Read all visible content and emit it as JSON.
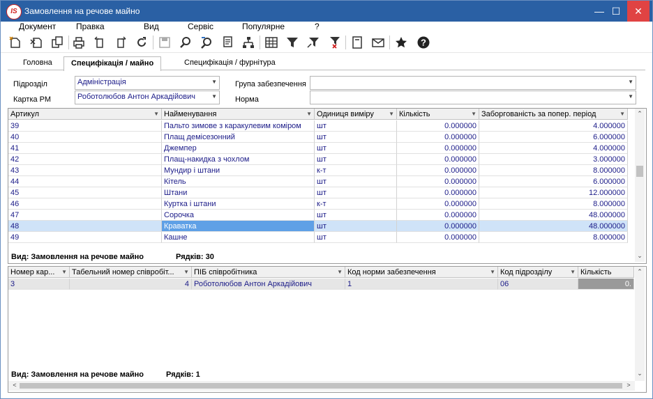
{
  "window": {
    "title": "Замовлення на речове майно",
    "logo": "IS"
  },
  "menu": [
    "Документ",
    "Правка",
    "Вид",
    "Сервіс",
    "Популярне",
    "?"
  ],
  "toolbar_icons": [
    "create-icon",
    "delete-icon",
    "copy-icon",
    "print-icon",
    "export-icon",
    "import-icon",
    "refresh-icon",
    "save-icon",
    "find-icon",
    "find-next-icon",
    "report-icon",
    "tree-icon",
    "table-icon",
    "filter-icon",
    "filter-edit-icon",
    "filter-clear-icon",
    "form-icon",
    "mail-icon",
    "star-icon",
    "help-icon"
  ],
  "tabs": [
    "Головна",
    "Специфікація / майно",
    "Специфікація / фурнітура"
  ],
  "form": {
    "podrozdil_label": "Підрозділ",
    "podrozdil_value": "Адміністрація",
    "kartka_label": "Картка РМ",
    "kartka_value": "Роботолюбов Антон Аркадійович",
    "grupa_label": "Група забезпечення",
    "grupa_value": "",
    "norma_label": "Норма",
    "norma_value": ""
  },
  "top_grid": {
    "columns": [
      "Артикул",
      "Найменування",
      "Одиниця виміру",
      "Кількість",
      "Заборгованість за попер. період"
    ],
    "rows": [
      [
        "39",
        "Пальто зимове з каракулевим коміром",
        "шт",
        "0.000000",
        "4.000000"
      ],
      [
        "40",
        "Плащ демісезонний",
        "шт",
        "0.000000",
        "6.000000"
      ],
      [
        "41",
        "Джемпер",
        "шт",
        "0.000000",
        "4.000000"
      ],
      [
        "42",
        "Плащ-накидка з чохлом",
        "шт",
        "0.000000",
        "3.000000"
      ],
      [
        "43",
        "Мундир і штани",
        "к-т",
        "0.000000",
        "8.000000"
      ],
      [
        "44",
        "Кітель",
        "шт",
        "0.000000",
        "6.000000"
      ],
      [
        "45",
        "Штани",
        "шт",
        "0.000000",
        "12.000000"
      ],
      [
        "46",
        "Куртка і штани",
        "к-т",
        "0.000000",
        "8.000000"
      ],
      [
        "47",
        "Сорочка",
        "шт",
        "0.000000",
        "48.000000"
      ],
      [
        "48",
        "Краватка",
        "шт",
        "0.000000",
        "48.000000"
      ],
      [
        "49",
        "Кашне",
        "шт",
        "0.000000",
        "8.000000"
      ]
    ],
    "selected_row": 9,
    "status_view": "Вид: Замовлення на речове майно",
    "status_rows": "Рядків: 30"
  },
  "bottom_grid": {
    "columns": [
      "Номер кар...",
      "Табельний номер співробіт...",
      "ПІБ співробітника",
      "Код норми забезпечення",
      "Код підрозділу",
      "Кількість"
    ],
    "rows": [
      [
        "3",
        "4",
        "Роботолюбов Антон Аркадійович",
        "1",
        "06",
        "0."
      ]
    ],
    "status_view": "Вид: Замовлення на речове майно",
    "status_rows": "Рядків: 1"
  }
}
